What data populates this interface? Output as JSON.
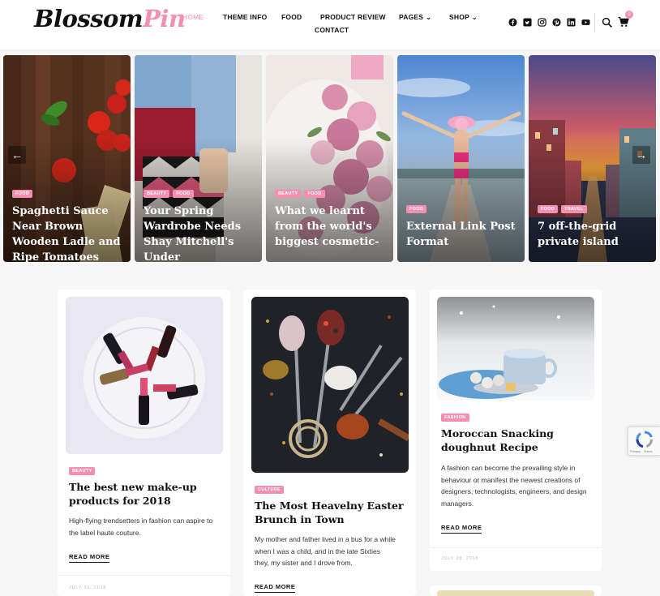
{
  "header": {
    "logo_part1": "Blossom",
    "logo_part2": "Pin",
    "nav": {
      "home": "HOME",
      "theme_info": "THEME INFO",
      "food": "FOOD",
      "product_review": "PRODUCT REVIEW",
      "pages": "PAGES",
      "shop": "SHOP",
      "contact": "CONTACT"
    },
    "cart_count": "0",
    "social_icons": [
      "facebook-icon",
      "twitter-icon",
      "instagram-icon",
      "pinterest-icon",
      "linkedin-icon",
      "youtube-icon"
    ]
  },
  "slider": {
    "prev_arrow": "←",
    "next_arrow": "→",
    "slides": [
      {
        "cats": [
          "FOOD"
        ],
        "title": "Spaghetti Sauce Near Brown Wooden Ladle and Ripe Tomatoes"
      },
      {
        "cats": [
          "BEAUTY",
          "FOOD"
        ],
        "title": "Your Spring Wardrobe Needs Shay Mitchell's Under"
      },
      {
        "cats": [
          "BEAUTY",
          "FOOD"
        ],
        "title": "What we learnt from the world's biggest cosmetic-"
      },
      {
        "cats": [
          "FOOD"
        ],
        "title": "External Link Post Format"
      },
      {
        "cats": [
          "FOOD",
          "TRAVEL"
        ],
        "title": "7 off-the-grid private island"
      }
    ]
  },
  "posts": [
    {
      "cat": "BEAUTY",
      "title": "The best new make-up products for 2018",
      "excerpt": "High-flying trendsetters in fashion can aspire to the label haute couture.",
      "read_more": "READ MORE",
      "date": "JULY 21, 2018"
    },
    {
      "cat": "CULTURE",
      "title": "The Most Heavelny Easter Brunch in Town",
      "excerpt": "My mother and father lived in a bus for a while when I was a child, and in the late Sixties they, my sister and I drove from.",
      "read_more": "READ MORE"
    },
    {
      "cat": "FASHION",
      "title": "Moroccan Snacking doughnut Recipe",
      "excerpt": "A fashion can become the prevailing style in behaviour or manifest the newest creations of designers, technologists, engineers, and design managers.",
      "read_more": "READ MORE",
      "date": "JULY 28, 2018"
    }
  ],
  "recaptcha": {
    "text": "Privacy - Terms"
  },
  "colors": {
    "accent": "#f48fb1"
  }
}
